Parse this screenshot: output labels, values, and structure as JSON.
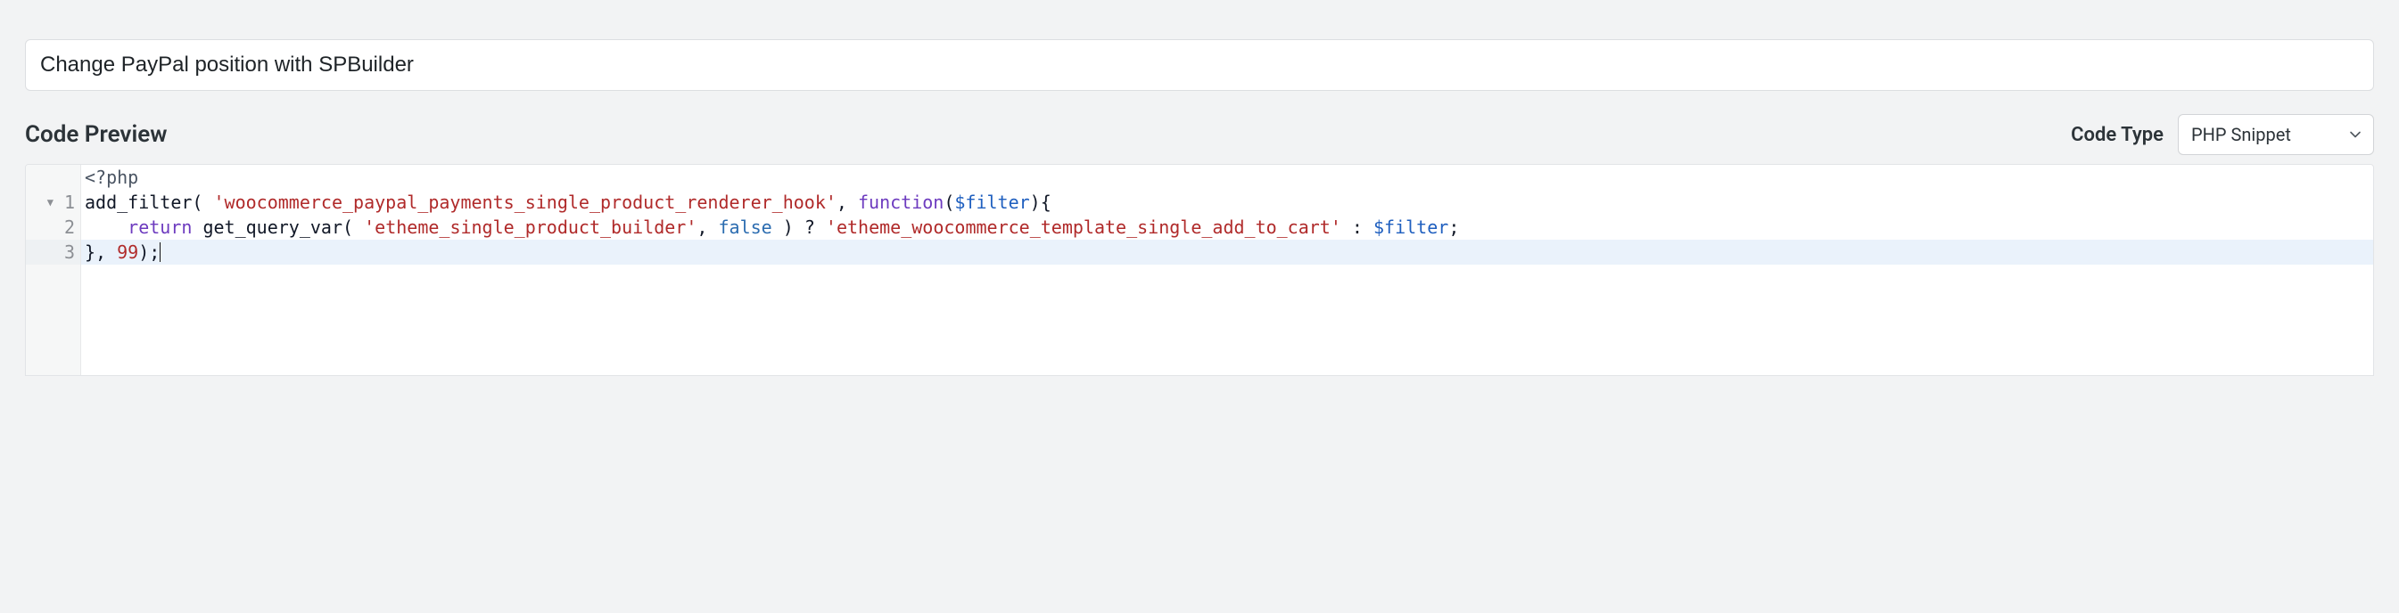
{
  "title_value": "Change PayPal position with SPBuilder",
  "preview_heading": "Code Preview",
  "code_type_label": "Code Type",
  "code_type_selected": "PHP Snippet",
  "code_type_options": [
    "PHP Snippet"
  ],
  "gutter": {
    "fold_marker": "▼",
    "line_numbers": [
      "1",
      "2",
      "3"
    ]
  },
  "code": {
    "line0": {
      "meta": "<?php"
    },
    "line1": {
      "fn": "add_filter",
      "open": "( ",
      "str": "'woocommerce_paypal_payments_single_product_renderer_hook'",
      "sep": ", ",
      "kw": "function",
      "args_open": "(",
      "var": "$filter",
      "args_close": "){"
    },
    "line2": {
      "indent": "    ",
      "kw": "return",
      "sp1": " ",
      "fn": "get_query_var",
      "open": "( ",
      "str1": "'etheme_single_product_builder'",
      "sep1": ", ",
      "const": "false",
      "close1": " ) ? ",
      "str2": "'etheme_woocommerce_template_single_add_to_cart'",
      "sep2": " : ",
      "var": "$filter",
      "end": ";"
    },
    "line3": {
      "close": "}, ",
      "num": "99",
      "end": ");"
    }
  }
}
